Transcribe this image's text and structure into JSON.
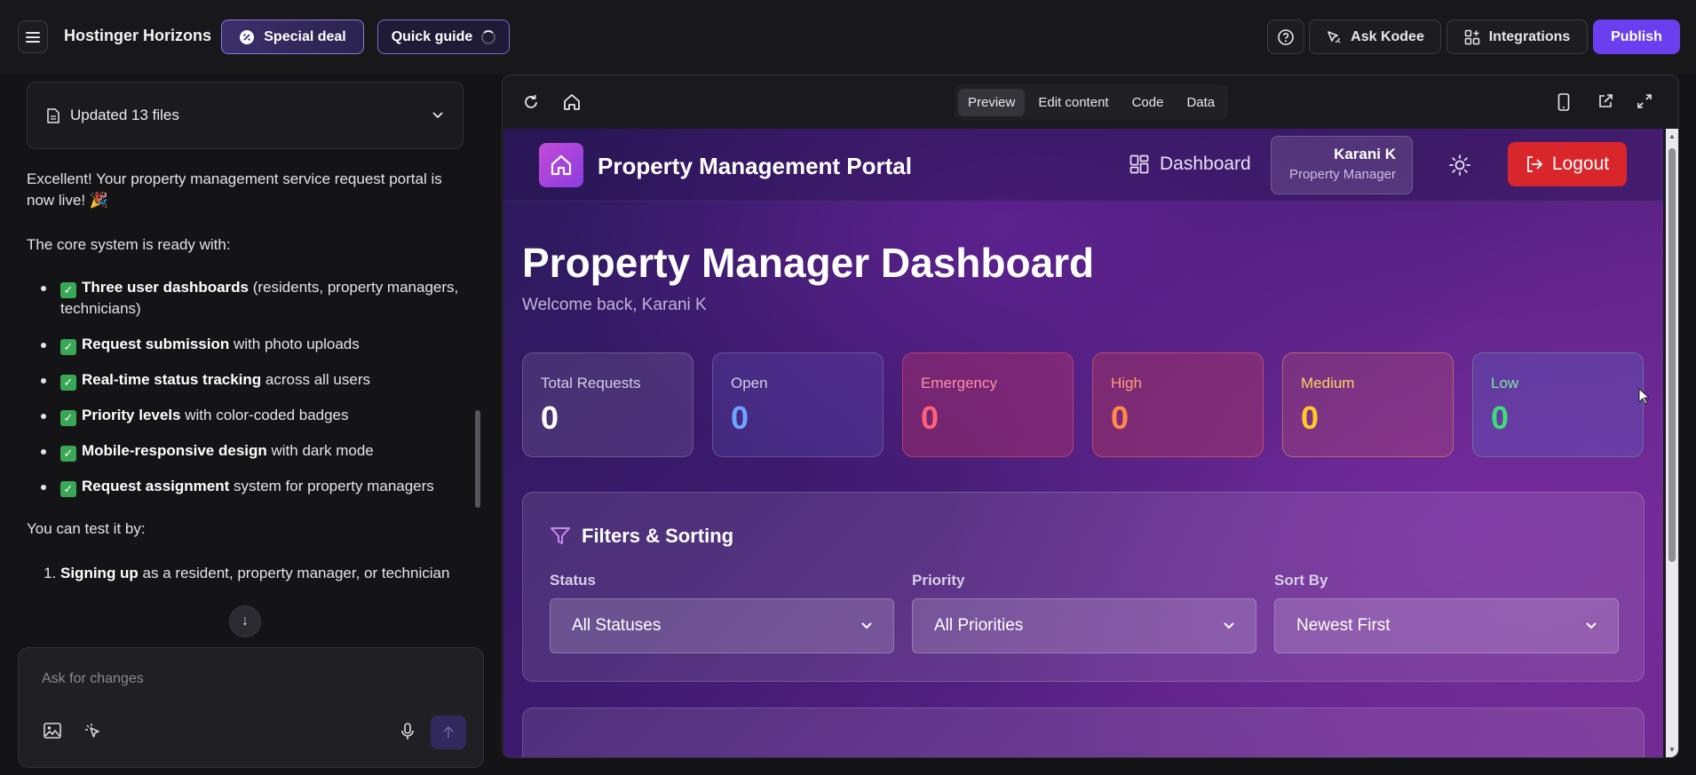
{
  "topbar": {
    "brand": "Hostinger Horizons",
    "special_deal": "Special deal",
    "quick_guide": "Quick guide",
    "ask_kodee": "Ask Kodee",
    "integrations": "Integrations",
    "publish": "Publish"
  },
  "chat": {
    "files_summary": "Updated 13 files",
    "intro": "Excellent! Your property management service request portal is now live! 🎉",
    "core_heading": "The core system is ready with:",
    "features": [
      {
        "bold": "Three user dashboards",
        "rest": " (residents, property managers, technicians)"
      },
      {
        "bold": "Request submission",
        "rest": " with photo uploads"
      },
      {
        "bold": "Real-time status tracking",
        "rest": " across all users"
      },
      {
        "bold": "Priority levels",
        "rest": " with color-coded badges"
      },
      {
        "bold": "Mobile-responsive design",
        "rest": " with dark mode"
      },
      {
        "bold": "Request assignment",
        "rest": " system for property managers"
      }
    ],
    "test_heading": "You can test it by:",
    "steps": [
      {
        "bold": "Signing up",
        "rest": " as a resident, property manager, or technician"
      }
    ],
    "composer_placeholder": "Ask for changes"
  },
  "preview": {
    "tabs": [
      "Preview",
      "Edit content",
      "Code",
      "Data"
    ],
    "active_tab": "Preview"
  },
  "app": {
    "title": "Property Management Portal",
    "nav_dashboard": "Dashboard",
    "user_name": "Karani K",
    "user_role": "Property Manager",
    "logout": "Logout",
    "page_title": "Property Manager Dashboard",
    "welcome": "Welcome back, Karani K",
    "stats": [
      {
        "label": "Total Requests",
        "value": "0"
      },
      {
        "label": "Open",
        "value": "0"
      },
      {
        "label": "Emergency",
        "value": "0"
      },
      {
        "label": "High",
        "value": "0"
      },
      {
        "label": "Medium",
        "value": "0"
      },
      {
        "label": "Low",
        "value": "0"
      }
    ],
    "filters": {
      "heading": "Filters & Sorting",
      "status_label": "Status",
      "status_value": "All Statuses",
      "priority_label": "Priority",
      "priority_value": "All Priorities",
      "sort_label": "Sort By",
      "sort_value": "Newest First"
    }
  },
  "colors": {
    "publish": "#6b3ff0",
    "logout": "#d9262b",
    "open": "#6ea3ff",
    "emergency": "#ff6178",
    "high": "#ff8a4a",
    "medium": "#ffc928",
    "low": "#3ddc7a"
  }
}
